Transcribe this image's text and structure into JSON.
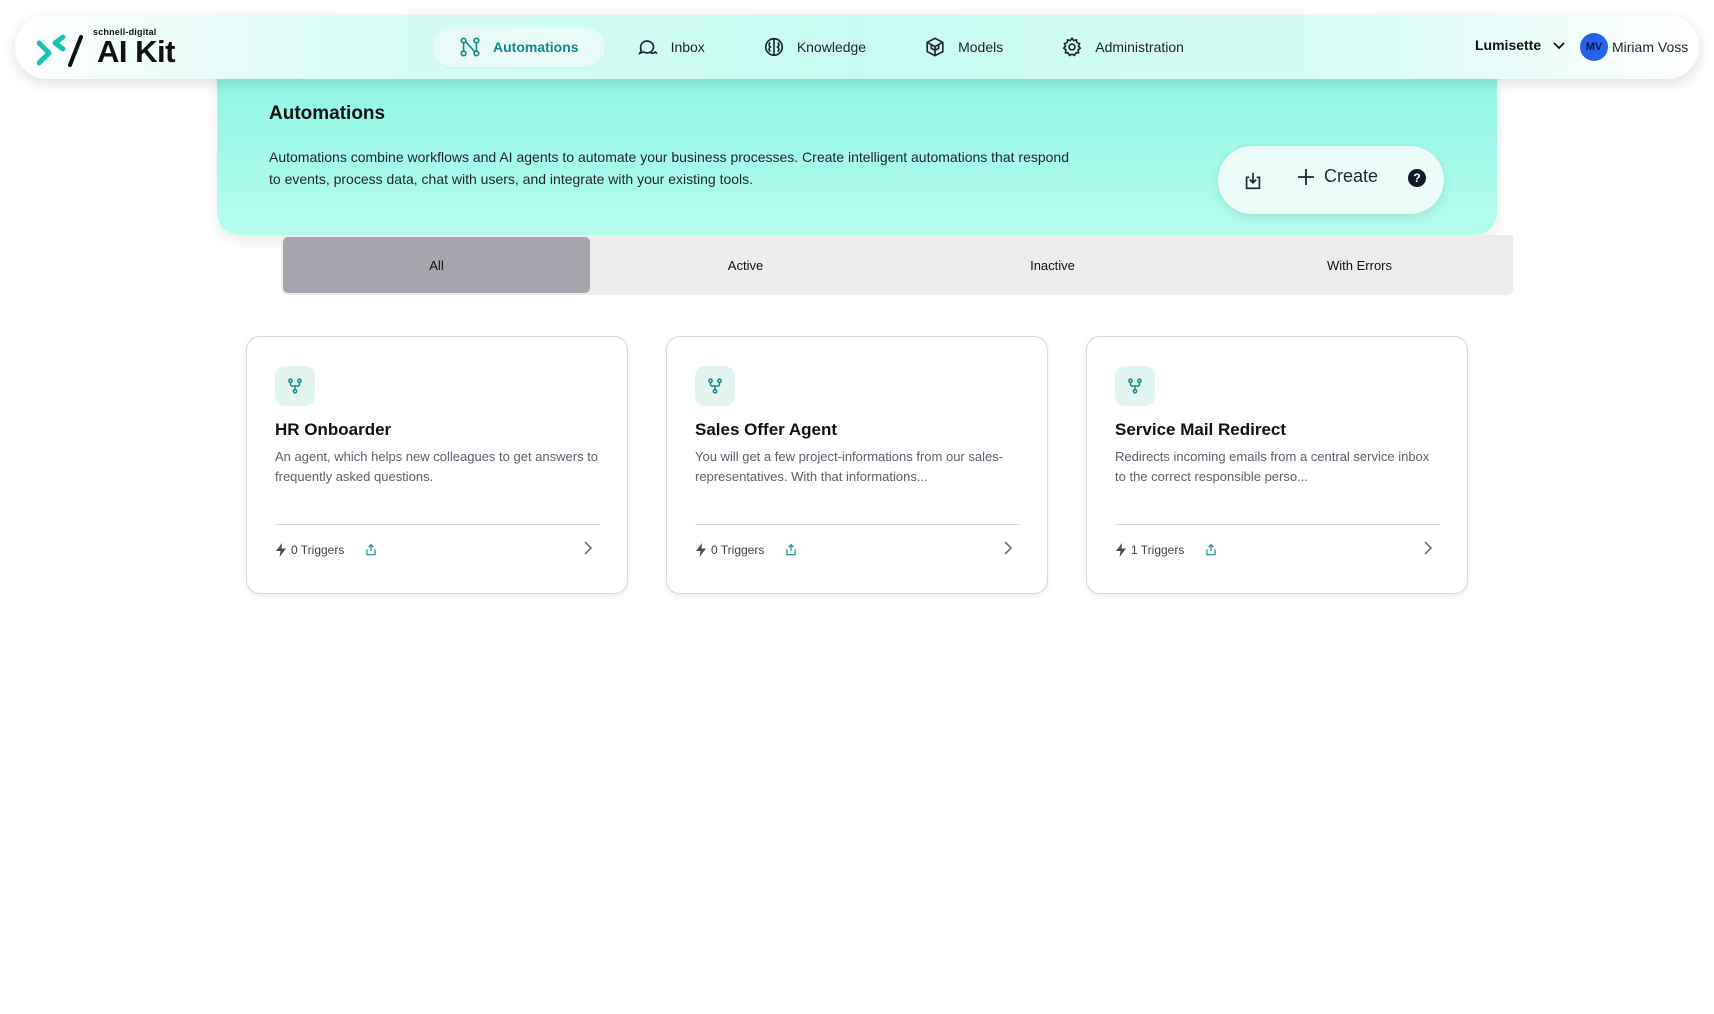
{
  "brand": {
    "small": "schnell-digital",
    "main": "AI Kit"
  },
  "nav": {
    "items": [
      {
        "label": "Automations",
        "icon": "automation-icon",
        "active": true
      },
      {
        "label": "Inbox",
        "icon": "chat-icon",
        "active": false
      },
      {
        "label": "Knowledge",
        "icon": "brain-icon",
        "active": false
      },
      {
        "label": "Models",
        "icon": "cube-icon",
        "active": false
      },
      {
        "label": "Administration",
        "icon": "gear-icon",
        "active": false
      }
    ]
  },
  "org": {
    "name": "Lumisette"
  },
  "user": {
    "initials": "MV",
    "name": "Miriam Voss"
  },
  "hero": {
    "title": "Automations",
    "description": "Automations combine workflows and AI agents to automate your business processes. Create intelligent automations that respond to events, process data, chat with users, and integrate with your existing tools.",
    "create_label": "Create",
    "help_label": "?"
  },
  "tabs": [
    {
      "label": "All",
      "active": true
    },
    {
      "label": "Active",
      "active": false
    },
    {
      "label": "Inactive",
      "active": false
    },
    {
      "label": "With Errors",
      "active": false
    }
  ],
  "cards": [
    {
      "title": "HR Onboarder",
      "description": "An agent, which helps new colleagues to get answers to frequently asked questions.",
      "triggers": "0 Triggers"
    },
    {
      "title": "Sales Offer Agent",
      "description": "You will get a few project-informations from our sales-representatives. With that informations...",
      "triggers": "0 Triggers"
    },
    {
      "title": "Service Mail Redirect",
      "description": "Redirects incoming emails from a central service inbox to the correct responsible perso...",
      "triggers": "1 Triggers"
    }
  ],
  "colors": {
    "accent": "#0f8b85",
    "hero": "#8ef5e3",
    "avatar": "#2563eb"
  }
}
